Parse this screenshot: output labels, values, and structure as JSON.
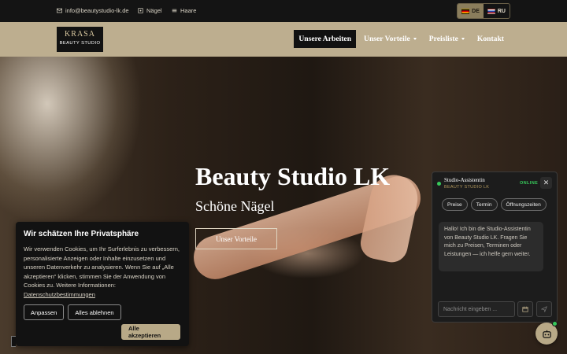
{
  "topbar": {
    "email": "info@beautystudio-lk.de",
    "link_nails": "Nägel",
    "link_hair": "Haare",
    "languages": [
      {
        "code": "DE",
        "active": true
      },
      {
        "code": "RU",
        "active": false
      }
    ]
  },
  "nav": {
    "logo_brand": "KRASA",
    "logo_sub": "BEAUTY STUDIO",
    "items": [
      {
        "label": "Unsere Arbeiten",
        "active": true,
        "dropdown": false
      },
      {
        "label": "Unser Vorteile",
        "active": false,
        "dropdown": true
      },
      {
        "label": "Preisliste",
        "active": false,
        "dropdown": true
      },
      {
        "label": "Kontakt",
        "active": false,
        "dropdown": false
      }
    ]
  },
  "hero": {
    "title": "Beauty Studio LK",
    "subtitle": "Schöne Nägel",
    "button": "Unser Vorteile"
  },
  "cookie": {
    "title": "Wir schätzen Ihre Privatsphäre",
    "text": "Wir verwenden Cookies, um Ihr Surferlebnis zu verbessern, personalisierte Anzeigen oder Inhalte einzusetzen und unseren Datenverkehr zu analysieren. Wenn Sie auf „Alle akzeptieren“ klicken, stimmen Sie der Anwendung von Cookies zu. Weitere Informationen:",
    "link": "Datenschutzbestimmungen",
    "btn_customize": "Anpassen",
    "btn_reject": "Alles ablehnen",
    "btn_accept": "Alle akzeptieren"
  },
  "chat": {
    "title": "Studio-Assistentin",
    "subtitle": "BEAUTY STUDIO LK",
    "status": "ONLINE",
    "close": "✕",
    "chips": [
      "Preise",
      "Termin",
      "Öffnungszeiten"
    ],
    "message": "Hallo! Ich bin die Studio-Assistentin von Beauty Studio LK. Fragen Sie mich zu Preisen, Terminen oder Leistungen — ich helfe gern weiter.",
    "input_placeholder": "Nachricht eingeben ..."
  },
  "colors": {
    "nav_bg": "#bdae8f",
    "accent_gold": "#b8a987",
    "online_green": "#37c85a"
  }
}
